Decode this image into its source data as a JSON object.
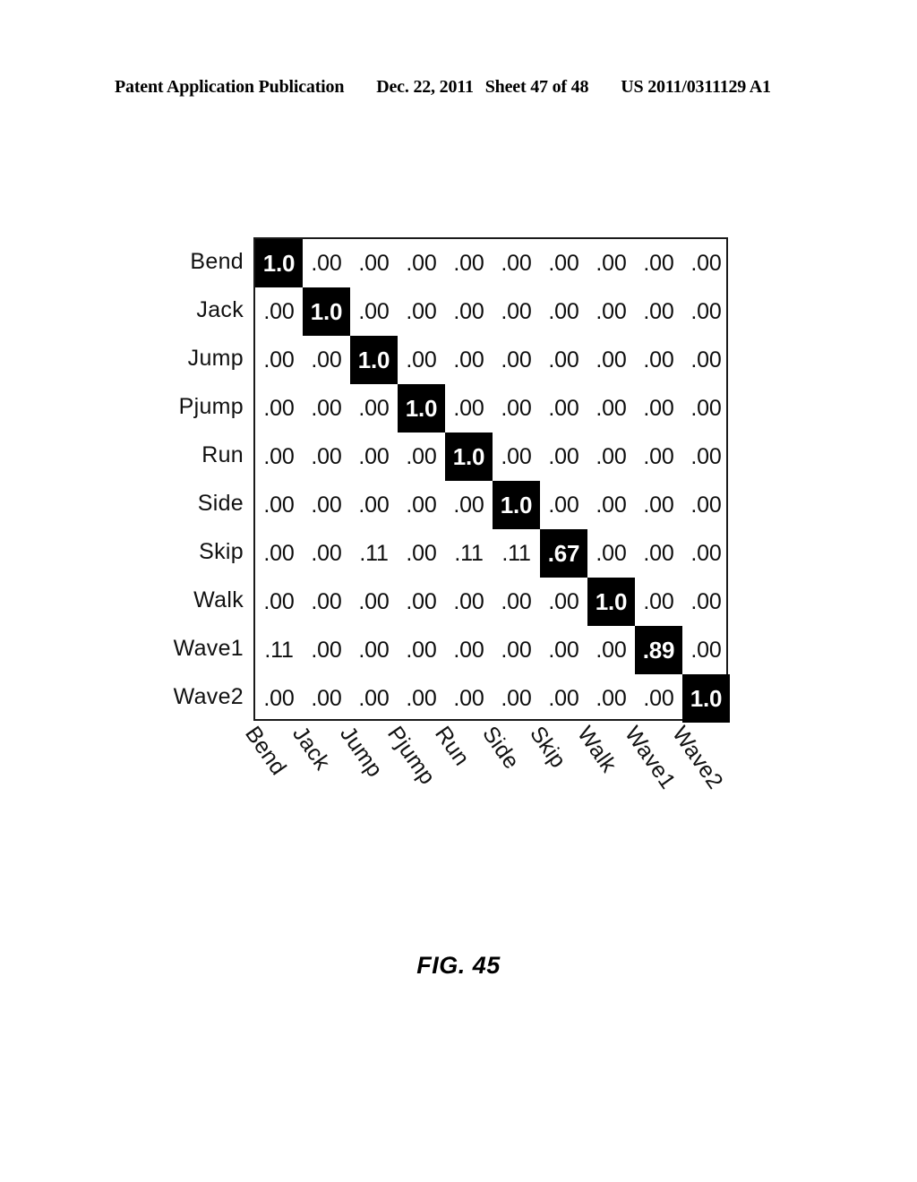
{
  "header": {
    "publication": "Patent Application Publication",
    "date": "Dec. 22, 2011",
    "sheet": "Sheet 47 of 48",
    "publication_number": "US 2011/0311129 A1"
  },
  "figure": {
    "caption": "FIG. 45"
  },
  "chart_data": {
    "type": "heatmap",
    "title": "FIG. 45",
    "xlabel": "",
    "ylabel": "",
    "grid": false,
    "legend": "none",
    "colors": {
      "highlight_background": "#000000",
      "highlight_text": "#ffffff",
      "cell_background": "#ffffff",
      "cell_text": "#000000",
      "border": "#1a1a1a"
    },
    "row_labels": [
      "Bend",
      "Jack",
      "Jump",
      "Pjump",
      "Run",
      "Side",
      "Skip",
      "Walk",
      "Wave1",
      "Wave2"
    ],
    "col_labels": [
      "Bend",
      "Jack",
      "Jump",
      "Pjump",
      "Run",
      "Side",
      "Skip",
      "Walk",
      "Wave1",
      "Wave2"
    ],
    "values": [
      [
        "1.0",
        ".00",
        ".00",
        ".00",
        ".00",
        ".00",
        ".00",
        ".00",
        ".00",
        ".00"
      ],
      [
        ".00",
        "1.0",
        ".00",
        ".00",
        ".00",
        ".00",
        ".00",
        ".00",
        ".00",
        ".00"
      ],
      [
        ".00",
        ".00",
        "1.0",
        ".00",
        ".00",
        ".00",
        ".00",
        ".00",
        ".00",
        ".00"
      ],
      [
        ".00",
        ".00",
        ".00",
        "1.0",
        ".00",
        ".00",
        ".00",
        ".00",
        ".00",
        ".00"
      ],
      [
        ".00",
        ".00",
        ".00",
        ".00",
        "1.0",
        ".00",
        ".00",
        ".00",
        ".00",
        ".00"
      ],
      [
        ".00",
        ".00",
        ".00",
        ".00",
        ".00",
        "1.0",
        ".00",
        ".00",
        ".00",
        ".00"
      ],
      [
        ".00",
        ".00",
        ".11",
        ".00",
        ".11",
        ".11",
        ".67",
        ".00",
        ".00",
        ".00"
      ],
      [
        ".00",
        ".00",
        ".00",
        ".00",
        ".00",
        ".00",
        ".00",
        "1.0",
        ".00",
        ".00"
      ],
      [
        ".11",
        ".00",
        ".00",
        ".00",
        ".00",
        ".00",
        ".00",
        ".00",
        ".89",
        ".00"
      ],
      [
        ".00",
        ".00",
        ".00",
        ".00",
        ".00",
        ".00",
        ".00",
        ".00",
        ".00",
        "1.0"
      ]
    ],
    "numeric_values": [
      [
        1.0,
        0.0,
        0.0,
        0.0,
        0.0,
        0.0,
        0.0,
        0.0,
        0.0,
        0.0
      ],
      [
        0.0,
        1.0,
        0.0,
        0.0,
        0.0,
        0.0,
        0.0,
        0.0,
        0.0,
        0.0
      ],
      [
        0.0,
        0.0,
        1.0,
        0.0,
        0.0,
        0.0,
        0.0,
        0.0,
        0.0,
        0.0
      ],
      [
        0.0,
        0.0,
        0.0,
        1.0,
        0.0,
        0.0,
        0.0,
        0.0,
        0.0,
        0.0
      ],
      [
        0.0,
        0.0,
        0.0,
        0.0,
        1.0,
        0.0,
        0.0,
        0.0,
        0.0,
        0.0
      ],
      [
        0.0,
        0.0,
        0.0,
        0.0,
        0.0,
        1.0,
        0.0,
        0.0,
        0.0,
        0.0
      ],
      [
        0.0,
        0.0,
        0.11,
        0.0,
        0.11,
        0.11,
        0.67,
        0.0,
        0.0,
        0.0
      ],
      [
        0.0,
        0.0,
        0.0,
        0.0,
        0.0,
        0.0,
        0.0,
        1.0,
        0.0,
        0.0
      ],
      [
        0.11,
        0.0,
        0.0,
        0.0,
        0.0,
        0.0,
        0.0,
        0.0,
        0.89,
        0.0
      ],
      [
        0.0,
        0.0,
        0.0,
        0.0,
        0.0,
        0.0,
        0.0,
        0.0,
        0.0,
        1.0
      ]
    ],
    "highlight_cells": [
      [
        0,
        0
      ],
      [
        1,
        1
      ],
      [
        2,
        2
      ],
      [
        3,
        3
      ],
      [
        4,
        4
      ],
      [
        5,
        5
      ],
      [
        6,
        6
      ],
      [
        7,
        7
      ],
      [
        8,
        8
      ],
      [
        9,
        9
      ]
    ]
  }
}
